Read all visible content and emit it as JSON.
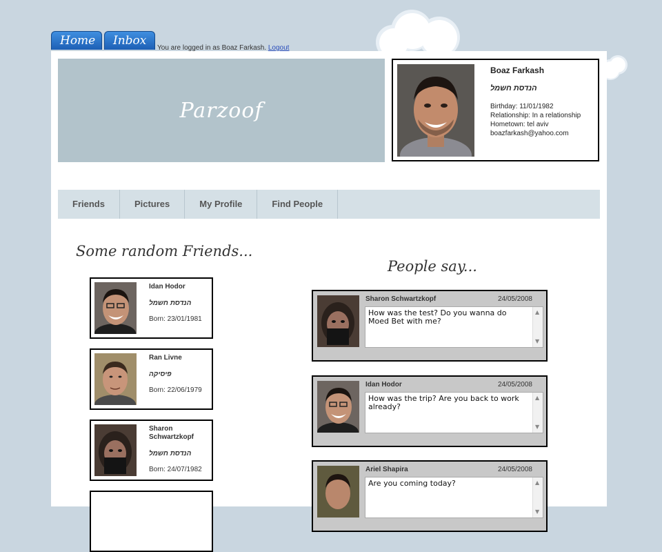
{
  "top_nav": {
    "home_label": "Home",
    "inbox_label": "Inbox",
    "login_text": "You are logged in as Boaz Farkash.",
    "logout_label": "Logout"
  },
  "banner": {
    "title": "Parzoof"
  },
  "profile": {
    "name": "Boaz Farkash",
    "dept": "הנדסת חשמל",
    "birthday": "Birthday: 11/01/1982",
    "relationship": "Relationship: In a relationship",
    "hometown": "Hometown: tel aviv",
    "email": "boazfarkash@yahoo.com"
  },
  "nav": {
    "items": [
      {
        "label": "Friends"
      },
      {
        "label": "Pictures"
      },
      {
        "label": "My Profile"
      },
      {
        "label": "Find People"
      }
    ]
  },
  "friends": {
    "title": "Some random Friends...",
    "items": [
      {
        "name": "Idan Hodor",
        "dept": "הנדסת חשמל",
        "born": "Born: 23/01/1981"
      },
      {
        "name": "Ran Livne",
        "dept": "פיסיקה",
        "born": "Born: 22/06/1979"
      },
      {
        "name": "Sharon Schwartzkopf",
        "dept": "הנדסת חשמל",
        "born": "Born: 24/07/1982"
      }
    ]
  },
  "messages": {
    "title": "People say...",
    "items": [
      {
        "author": "Sharon Schwartzkopf",
        "date": "24/05/2008",
        "text": "How was the test? Do you wanna do Moed Bet with me?"
      },
      {
        "author": "Idan Hodor",
        "date": "24/05/2008",
        "text": "How was the trip? Are you back to work already?"
      },
      {
        "author": "Ariel Shapira",
        "date": "24/05/2008",
        "text": "Are you coming today?"
      }
    ]
  },
  "colors": {
    "background": "#c9d6e0",
    "banner": "#b2c3cb",
    "navbar": "#d5e0e6",
    "tab_blue": "#1d5fb5",
    "message_bg": "#c8c8c8"
  }
}
